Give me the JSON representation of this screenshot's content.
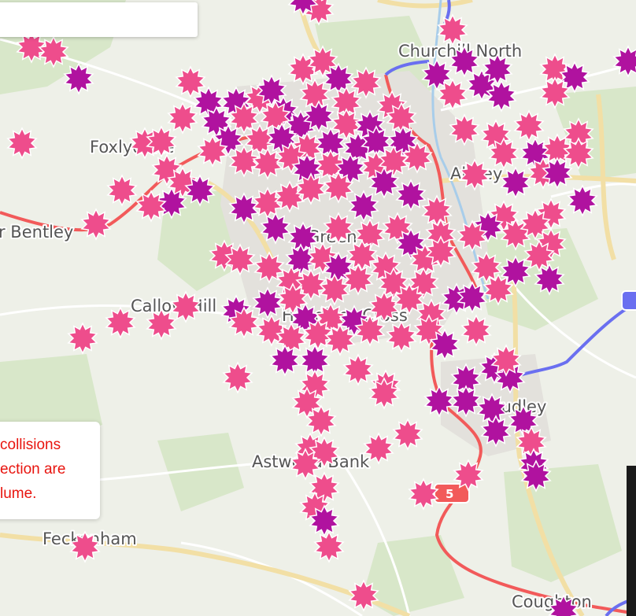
{
  "map": {
    "places": {
      "churchill_north": "Churchill North",
      "foxlydiate": "Foxlydiate",
      "upper_bentley": "r Bentley",
      "green": "Green",
      "callow_hill": "Callow Hill",
      "headless_cross": "Headless Cross",
      "astwood_bank": "Astwood Bank",
      "feckenham": "Feckenham",
      "coughton": "Coughton",
      "studley": "Studley",
      "abbey": "Abbey"
    },
    "road_shield_label": "5",
    "colors": {
      "severe_marker": "#b0129f",
      "slight_marker": "#ee4d8c",
      "major_road": "#f25a5a",
      "motorway": "#6a6ff0",
      "minor_road": "#f4e4b6"
    }
  },
  "search": {
    "value": ""
  },
  "info_panel": {
    "line1": "collisions",
    "line2": "ection are",
    "line3": "lume."
  }
}
